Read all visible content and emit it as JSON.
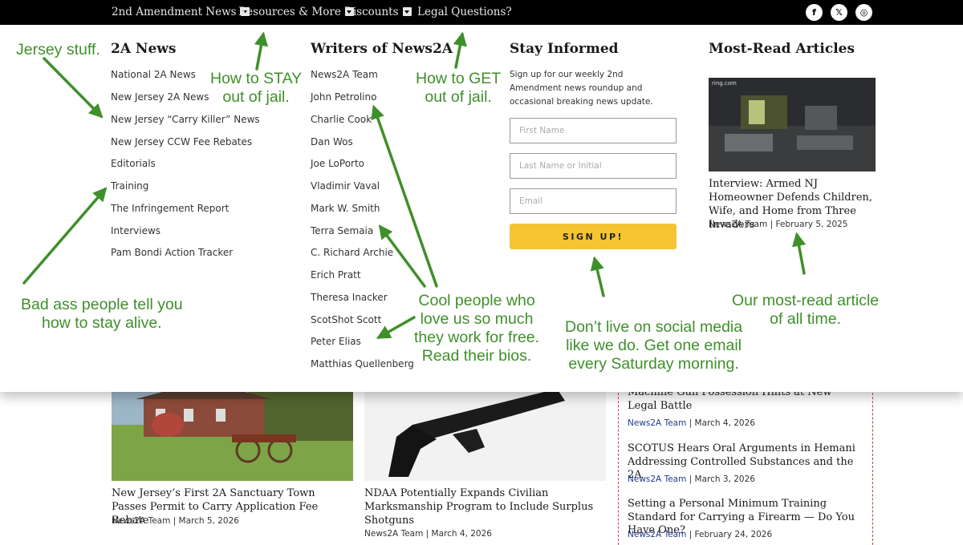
{
  "nav": {
    "items": [
      {
        "label": "2nd Amendment News"
      },
      {
        "label": "Resources & More"
      },
      {
        "label": "Discounts"
      },
      {
        "label": "Legal Questions?"
      }
    ],
    "social": [
      {
        "icon": "facebook-icon",
        "glyph": "f"
      },
      {
        "icon": "x-twitter-icon",
        "glyph": "𝕏"
      },
      {
        "icon": "instagram-icon",
        "glyph": "◎"
      }
    ]
  },
  "menu": {
    "news": {
      "title": "2A News",
      "links": [
        "National 2A News",
        "New Jersey 2A News",
        "New Jersey “Carry Killer” News",
        "New Jersey CCW Fee Rebates",
        "Editorials",
        "Training",
        "The Infringement Report",
        "Interviews",
        "Pam Bondi Action Tracker"
      ]
    },
    "writers": {
      "title": "Writers of News2A",
      "links": [
        "News2A Team",
        "John Petrolino",
        "Charlie Cook",
        "Dan Wos",
        "Joe LoPorto",
        "Vladimir Vaval",
        "Mark W. Smith",
        "Terra Semaia",
        "C. Richard Archie",
        "Erich Pratt",
        "Theresa Inacker",
        "ScotShot Scott",
        "Peter Elias",
        "Matthias Quellenberg"
      ]
    },
    "stay": {
      "title": "Stay Informed",
      "description": "Sign up for our weekly 2nd Amendment news roundup and occasional breaking news update.",
      "first_name_placeholder": "First Name",
      "last_name_placeholder": "Last Name or Initial",
      "email_placeholder": "Email",
      "button": "SIGN UP!"
    },
    "most_read": {
      "title": "Most-Read Articles",
      "image_caption": "ring.com",
      "article_title": "Interview: Armed NJ Homeowner Defends Children, Wife, and Home from Three Invaders",
      "author": "News2A Team",
      "date": "February 5, 2025"
    }
  },
  "annotations": {
    "jersey": "Jersey stuff.",
    "stay_out": [
      "How to STAY",
      "out of jail."
    ],
    "get_out": [
      "How to GET",
      "out of jail."
    ],
    "bad_ass": [
      "Bad ass people tell you",
      "how to stay alive."
    ],
    "cool_people": [
      "Cool people who",
      "love us so much",
      "they work for free.",
      "Read their bios."
    ],
    "social_media": [
      "Don’t live on social media",
      "like we do. Get one email",
      "every Saturday morning."
    ],
    "most_read": [
      "Our most-read article",
      "of all time."
    ],
    "color": "#3f8f2a"
  },
  "posts": [
    {
      "title": "New Jersey’s First 2A Sanctuary Town Passes Permit to Carry Application Fee Rebate",
      "author": "News2A Team",
      "date": "March 5, 2026"
    },
    {
      "title": "NDAA Potentially Expands Civilian Marksmanship Program to Include Surplus Shotguns",
      "author": "News2A Team",
      "date": "March 4, 2026"
    }
  ],
  "sidebar": {
    "items": [
      {
        "title": "Machine Gun Possession Hints at New Legal Battle",
        "author": "News2A Team",
        "date": "March 4, 2026"
      },
      {
        "title": "SCOTUS Hears Oral Arguments in Hemani Addressing Controlled Substances and the 2A",
        "author": "News2A Team",
        "date": "March 3, 2026"
      },
      {
        "title": "Setting a Personal Minimum Training Standard for Carrying a Firearm — Do You Have One?",
        "author": "News2A Team",
        "date": "February 24, 2026"
      }
    ]
  },
  "colors": {
    "nav_bg": "#000000",
    "signup_button": "#f5c431",
    "author_link": "#1f3c8c",
    "sidebar_border": "#d23a3a"
  }
}
